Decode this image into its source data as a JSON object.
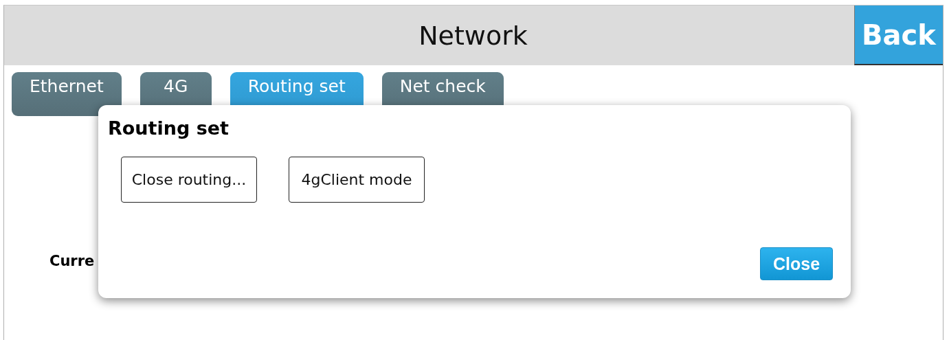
{
  "header": {
    "title": "Network",
    "back_button": "Back"
  },
  "tabs": [
    {
      "label": "Ethernet",
      "selected": false
    },
    {
      "label": "4G",
      "selected": false
    },
    {
      "label": "Routing set",
      "selected": true
    },
    {
      "label": "Net check",
      "selected": false
    }
  ],
  "content": {
    "label": "Curre"
  },
  "dialog": {
    "title": "Routing set",
    "options": [
      "Close routing...",
      "4gClient mode"
    ],
    "close_button": "Close"
  }
}
